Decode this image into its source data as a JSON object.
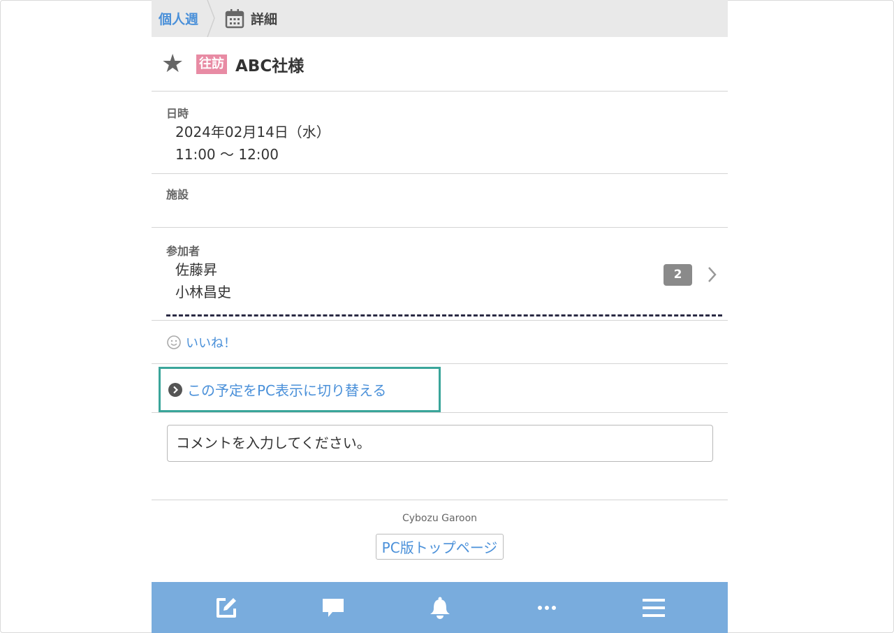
{
  "breadcrumb": {
    "home": "個人週",
    "current": "詳細"
  },
  "event": {
    "tag": "往訪",
    "title": "ABC社様"
  },
  "datetime": {
    "label": "日時",
    "date": "2024年02月14日（水）",
    "time": "11:00 〜 12:00"
  },
  "facility": {
    "label": "施設"
  },
  "attendees": {
    "label": "参加者",
    "names": [
      "佐藤昇",
      "小林昌史"
    ],
    "count": "2"
  },
  "like": {
    "label": "いいね！"
  },
  "pc_switch": {
    "label": "この予定をPC表示に切り替える"
  },
  "comment": {
    "placeholder": "コメントを入力してください。"
  },
  "footer": {
    "brand": "Cybozu Garoon",
    "pc_top": "PC版トップページ"
  },
  "tabbar": {
    "items": [
      "edit-icon",
      "chat-icon",
      "bell-icon",
      "more-icon",
      "menu-icon"
    ]
  },
  "colors": {
    "link": "#4a90d9",
    "tag": "#e88ba4",
    "tabbar": "#79acdd",
    "highlight": "#3aa59a"
  }
}
